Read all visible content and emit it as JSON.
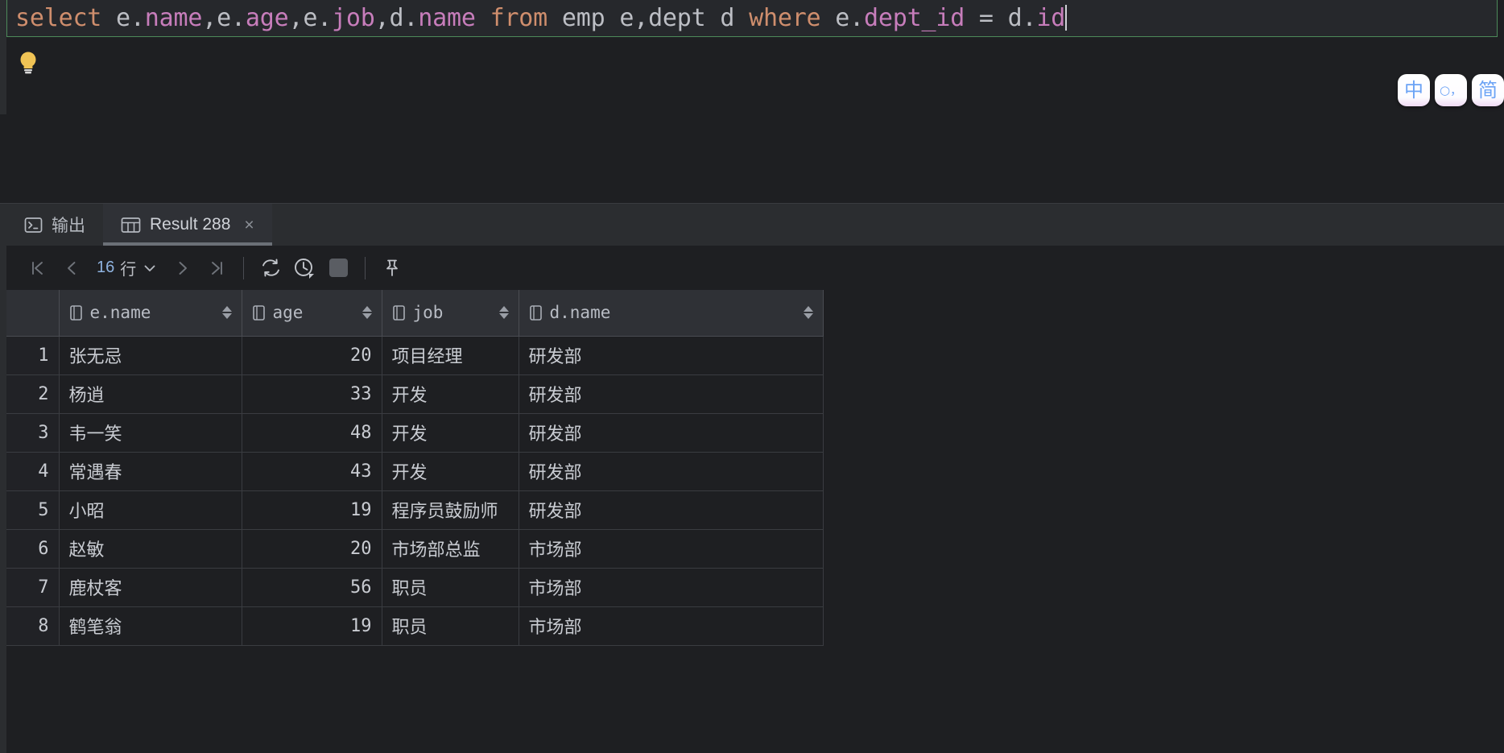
{
  "editor": {
    "sql_tokens": [
      {
        "t": "select",
        "c": "kw"
      },
      {
        "t": " ",
        "c": "punct"
      },
      {
        "t": "e.",
        "c": "ident"
      },
      {
        "t": "name",
        "c": "fld"
      },
      {
        "t": ",",
        "c": "punct"
      },
      {
        "t": "e.",
        "c": "ident"
      },
      {
        "t": "age",
        "c": "fld"
      },
      {
        "t": ",",
        "c": "punct"
      },
      {
        "t": "e.",
        "c": "ident"
      },
      {
        "t": "job",
        "c": "fld"
      },
      {
        "t": ",",
        "c": "punct"
      },
      {
        "t": "d.",
        "c": "ident"
      },
      {
        "t": "name",
        "c": "fld"
      },
      {
        "t": " ",
        "c": "punct"
      },
      {
        "t": "from",
        "c": "kw"
      },
      {
        "t": " ",
        "c": "punct"
      },
      {
        "t": "emp e,dept d ",
        "c": "ident"
      },
      {
        "t": "where",
        "c": "kw"
      },
      {
        "t": " ",
        "c": "punct"
      },
      {
        "t": "e.",
        "c": "ident"
      },
      {
        "t": "dept_id",
        "c": "fld"
      },
      {
        "t": " = ",
        "c": "ident"
      },
      {
        "t": "d.",
        "c": "ident"
      },
      {
        "t": "id",
        "c": "fld"
      }
    ],
    "sql_text": "select e.name,e.age,e.job,d.name from emp e,dept d where e.dept_id = d.id",
    "statement_border_color": "#4d8a5a",
    "intention_icon": "lightbulb-icon"
  },
  "ime": {
    "keys": [
      {
        "label": "中",
        "name": "ime-chinese-mode-key",
        "size": "big"
      },
      {
        "label": "○，",
        "name": "ime-punctuation-key",
        "size": "small"
      },
      {
        "label": "简",
        "name": "ime-simplified-key",
        "size": "big"
      }
    ]
  },
  "results": {
    "tabs": [
      {
        "label": "输出",
        "icon": "console-icon",
        "active": false,
        "closable": false
      },
      {
        "label": "Result 288",
        "icon": "table-icon",
        "active": true,
        "closable": true,
        "close_label": "×"
      }
    ],
    "toolbar": {
      "first_page": "first-page-icon",
      "prev_page": "prev-page-icon",
      "row_count_number": "16",
      "row_count_unit": "行",
      "row_count_chevron": "chevron-down-icon",
      "next_page": "next-page-icon",
      "last_page": "last-page-icon",
      "reload": "reload-icon",
      "history": "history-clock-icon",
      "stop": "stop-icon",
      "pin": "pin-icon"
    },
    "grid": {
      "columns": [
        {
          "label": "e.name",
          "align": "left"
        },
        {
          "label": "age",
          "align": "right"
        },
        {
          "label": "job",
          "align": "left"
        },
        {
          "label": "d.name",
          "align": "left"
        }
      ],
      "rows": [
        {
          "n": "1",
          "cells": [
            "张无忌",
            "20",
            "项目经理",
            "研发部"
          ]
        },
        {
          "n": "2",
          "cells": [
            "杨逍",
            "33",
            "开发",
            "研发部"
          ]
        },
        {
          "n": "3",
          "cells": [
            "韦一笑",
            "48",
            "开发",
            "研发部"
          ]
        },
        {
          "n": "4",
          "cells": [
            "常遇春",
            "43",
            "开发",
            "研发部"
          ]
        },
        {
          "n": "5",
          "cells": [
            "小昭",
            "19",
            "程序员鼓励师",
            "研发部"
          ]
        },
        {
          "n": "6",
          "cells": [
            "赵敏",
            "20",
            "市场部总监",
            "市场部"
          ]
        },
        {
          "n": "7",
          "cells": [
            "鹿杖客",
            "56",
            "职员",
            "市场部"
          ]
        },
        {
          "n": "8",
          "cells": [
            "鹤笔翁",
            "19",
            "职员",
            "市场部"
          ]
        }
      ]
    }
  },
  "colors": {
    "background": "#1e1f22",
    "panel": "#2b2d30",
    "keyword": "#cf8e6d",
    "field": "#c77dbb",
    "identifier": "#bcbec4",
    "accent_green": "#4d8a5a",
    "row_number": "#6d7078"
  }
}
